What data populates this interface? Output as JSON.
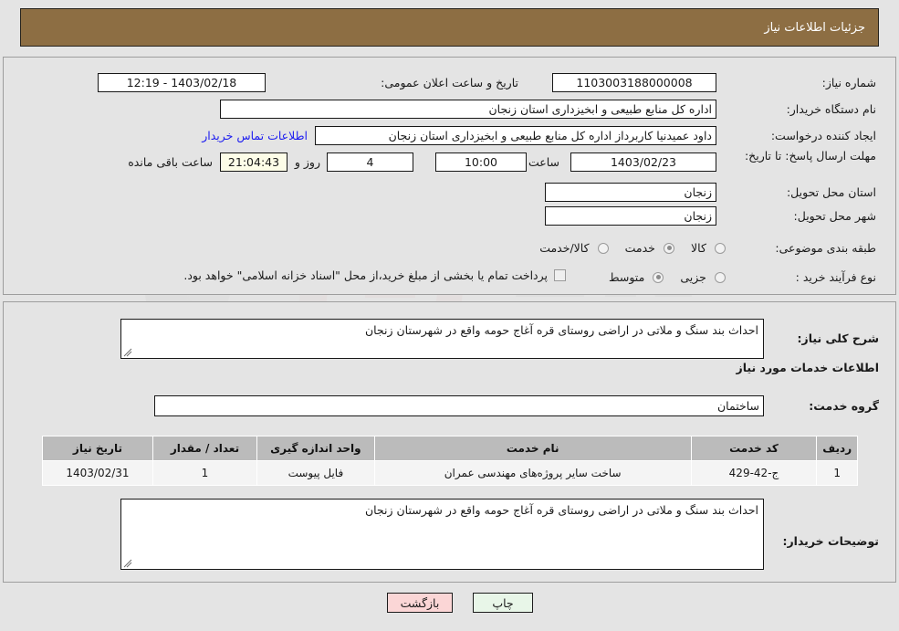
{
  "header": {
    "title": "جزئیات اطلاعات نیاز"
  },
  "top_form": {
    "need_number_label": "شماره نیاز:",
    "need_number_value": "1103003188000008",
    "public_announce_label": "تاریخ و ساعت اعلان عمومی:",
    "public_announce_value": "1403/02/18 - 12:19",
    "buyer_org_label": "نام دستگاه خریدار:",
    "buyer_org_value": "اداره کل منابع طبیعی و ابخیزداری استان زنجان",
    "creator_label": "ایجاد کننده درخواست:",
    "creator_value": "داود عمیدنیا کاربرداز اداره کل منابع طبیعی و ابخیزداری استان زنجان",
    "contact_link": "اطلاعات تماس خریدار",
    "deadline_label": "مهلت ارسال پاسخ: تا تاریخ:",
    "deadline_date": "1403/02/23",
    "hour_label": "ساعت",
    "deadline_time": "10:00",
    "days_value": "4",
    "days_label": "روز و",
    "timer_value": "21:04:43",
    "remaining_label": "ساعت باقی مانده",
    "province_label": "استان محل تحویل:",
    "province_value": "زنجان",
    "city_label": "شهر محل تحویل:",
    "city_value": "زنجان",
    "category_label": "طبقه بندی موضوعی:",
    "category_options": [
      {
        "label": "کالا",
        "selected": false
      },
      {
        "label": "خدمت",
        "selected": true
      },
      {
        "label": "کالا/خدمت",
        "selected": false
      }
    ],
    "process_label": "نوع فرآیند خرید :",
    "process_options": [
      {
        "label": "جزیی",
        "selected": false
      },
      {
        "label": "متوسط",
        "selected": true
      }
    ],
    "treasury_checkbox_label": "پرداخت تمام یا بخشی از مبلغ خرید،از محل \"اسناد خزانه اسلامی\" خواهد بود.",
    "treasury_checked": false
  },
  "details": {
    "general_desc_label": "شرح کلی نیاز:",
    "general_desc_value": "احداث بند سنگ و ملاتی در اراضی روستای قره آغاج حومه واقع در شهرستان زنجان",
    "services_heading": "اطلاعات خدمات مورد نیاز",
    "service_group_label": "گروه خدمت:",
    "service_group_value": "ساختمان",
    "buyer_notes_label": "توضیحات خریدار:",
    "buyer_notes_value": "احداث بند سنگ و ملاتی در اراضی روستای قره آغاج حومه واقع در شهرستان زنجان"
  },
  "table": {
    "columns": [
      "ردیف",
      "کد خدمت",
      "نام خدمت",
      "واحد اندازه گیری",
      "تعداد / مقدار",
      "تاریخ نیاز"
    ],
    "rows": [
      [
        "1",
        "ج-42-429",
        "ساخت سایر پروژه‌های مهندسی عمران",
        "فایل پیوست",
        "1",
        "1403/02/31"
      ]
    ]
  },
  "footer": {
    "print_label": "چاپ",
    "back_label": "بازگشت"
  },
  "colors": {
    "header_bg": "#8d6e43",
    "page_bg": "#e4e4e4",
    "link": "#1c1cf0",
    "table_header_bg": "#bbbbbb",
    "timer_bg": "#fdfde8",
    "btn_print_bg": "#e8f6e8",
    "btn_back_bg": "#fbd6d6"
  },
  "watermark": {
    "text": "AriaTender.net"
  }
}
